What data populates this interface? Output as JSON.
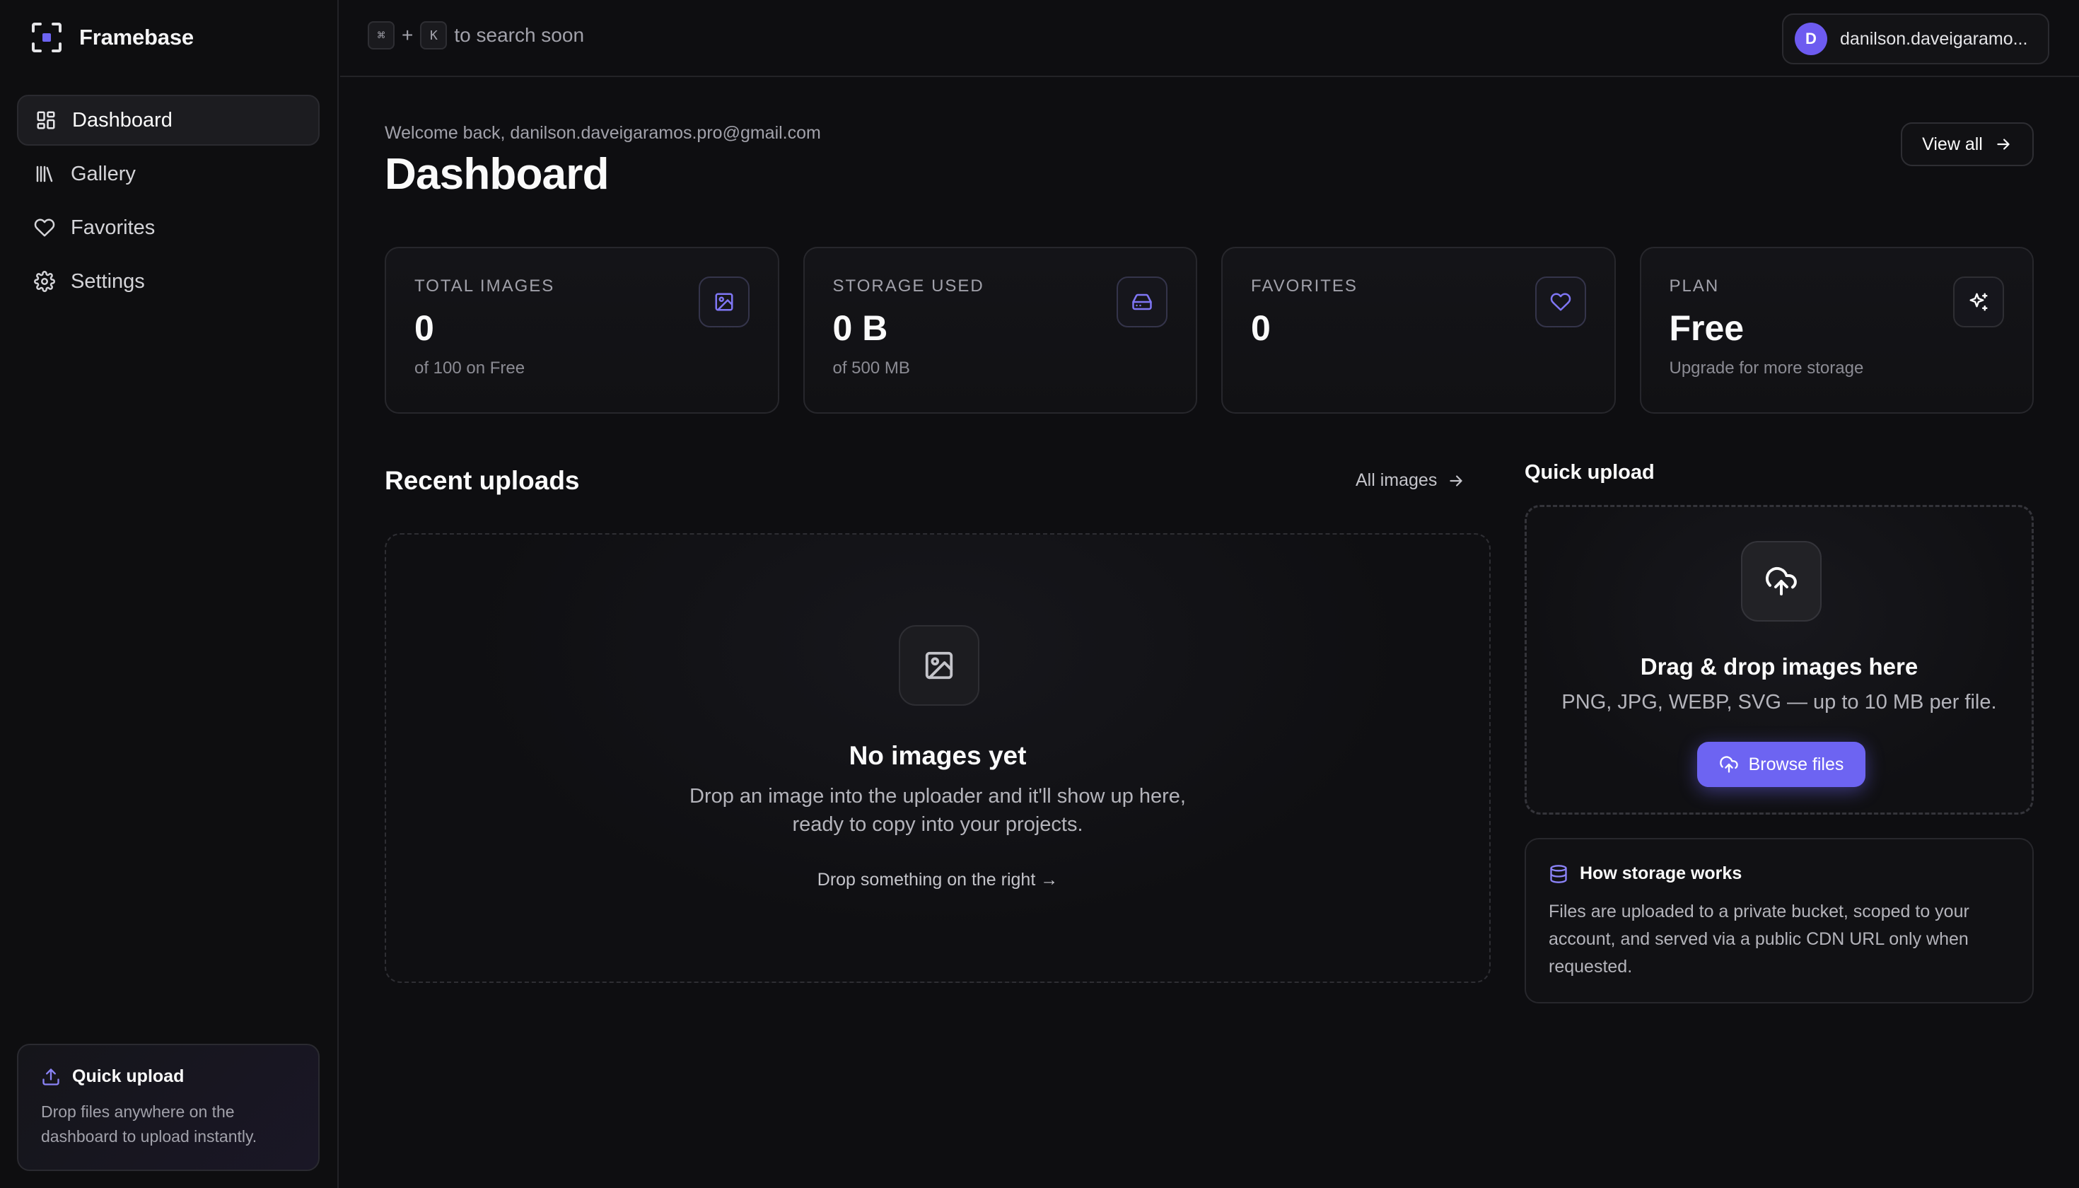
{
  "app": {
    "name": "Framebase"
  },
  "sidebar": {
    "items": [
      {
        "label": "Dashboard",
        "icon": "dashboard-icon",
        "active": true
      },
      {
        "label": "Gallery",
        "icon": "library-icon",
        "active": false
      },
      {
        "label": "Favorites",
        "icon": "heart-icon",
        "active": false
      },
      {
        "label": "Settings",
        "icon": "gear-icon",
        "active": false
      }
    ],
    "quick_upload": {
      "title": "Quick upload",
      "text": "Drop files anywhere on the dashboard to upload instantly."
    }
  },
  "topbar": {
    "kbd_cmd": "⌘",
    "kbd_plus": "+",
    "kbd_key": "K",
    "hint": "to search soon",
    "user": {
      "initial": "D",
      "name": "danilson.daveigaramo..."
    }
  },
  "header": {
    "welcome": "Welcome back, danilson.daveigaramos.pro@gmail.com",
    "title": "Dashboard",
    "view_all": "View all"
  },
  "stats": [
    {
      "label": "TOTAL IMAGES",
      "value": "0",
      "sub": "of 100 on Free",
      "icon": "image-icon"
    },
    {
      "label": "STORAGE USED",
      "value": "0 B",
      "sub": "of 500 MB",
      "icon": "hard-drive-icon"
    },
    {
      "label": "FAVORITES",
      "value": "0",
      "sub": "",
      "icon": "heart-icon"
    },
    {
      "label": "PLAN",
      "value": "Free",
      "sub": "Upgrade for more storage",
      "icon": "sparkles-icon"
    }
  ],
  "recent": {
    "title": "Recent uploads",
    "all_images": "All images",
    "empty_title": "No images yet",
    "empty_text_1": "Drop an image into the uploader and it'll show up here,",
    "empty_text_2": "ready to copy into your projects.",
    "empty_link": "Drop something on the right →"
  },
  "quick_upload": {
    "title": "Quick upload",
    "drop_title": "Drag & drop images here",
    "drop_text": "PNG, JPG, WEBP, SVG — up to 10 MB per file.",
    "browse": "Browse files"
  },
  "storage_info": {
    "title": "How storage works",
    "text": "Files are uploaded to a private bucket, scoped to your account, and served via a public CDN URL only when requested."
  },
  "colors": {
    "accent": "#6d64f2",
    "avatar": "#6d5bf0",
    "background": "#0e0e11"
  }
}
